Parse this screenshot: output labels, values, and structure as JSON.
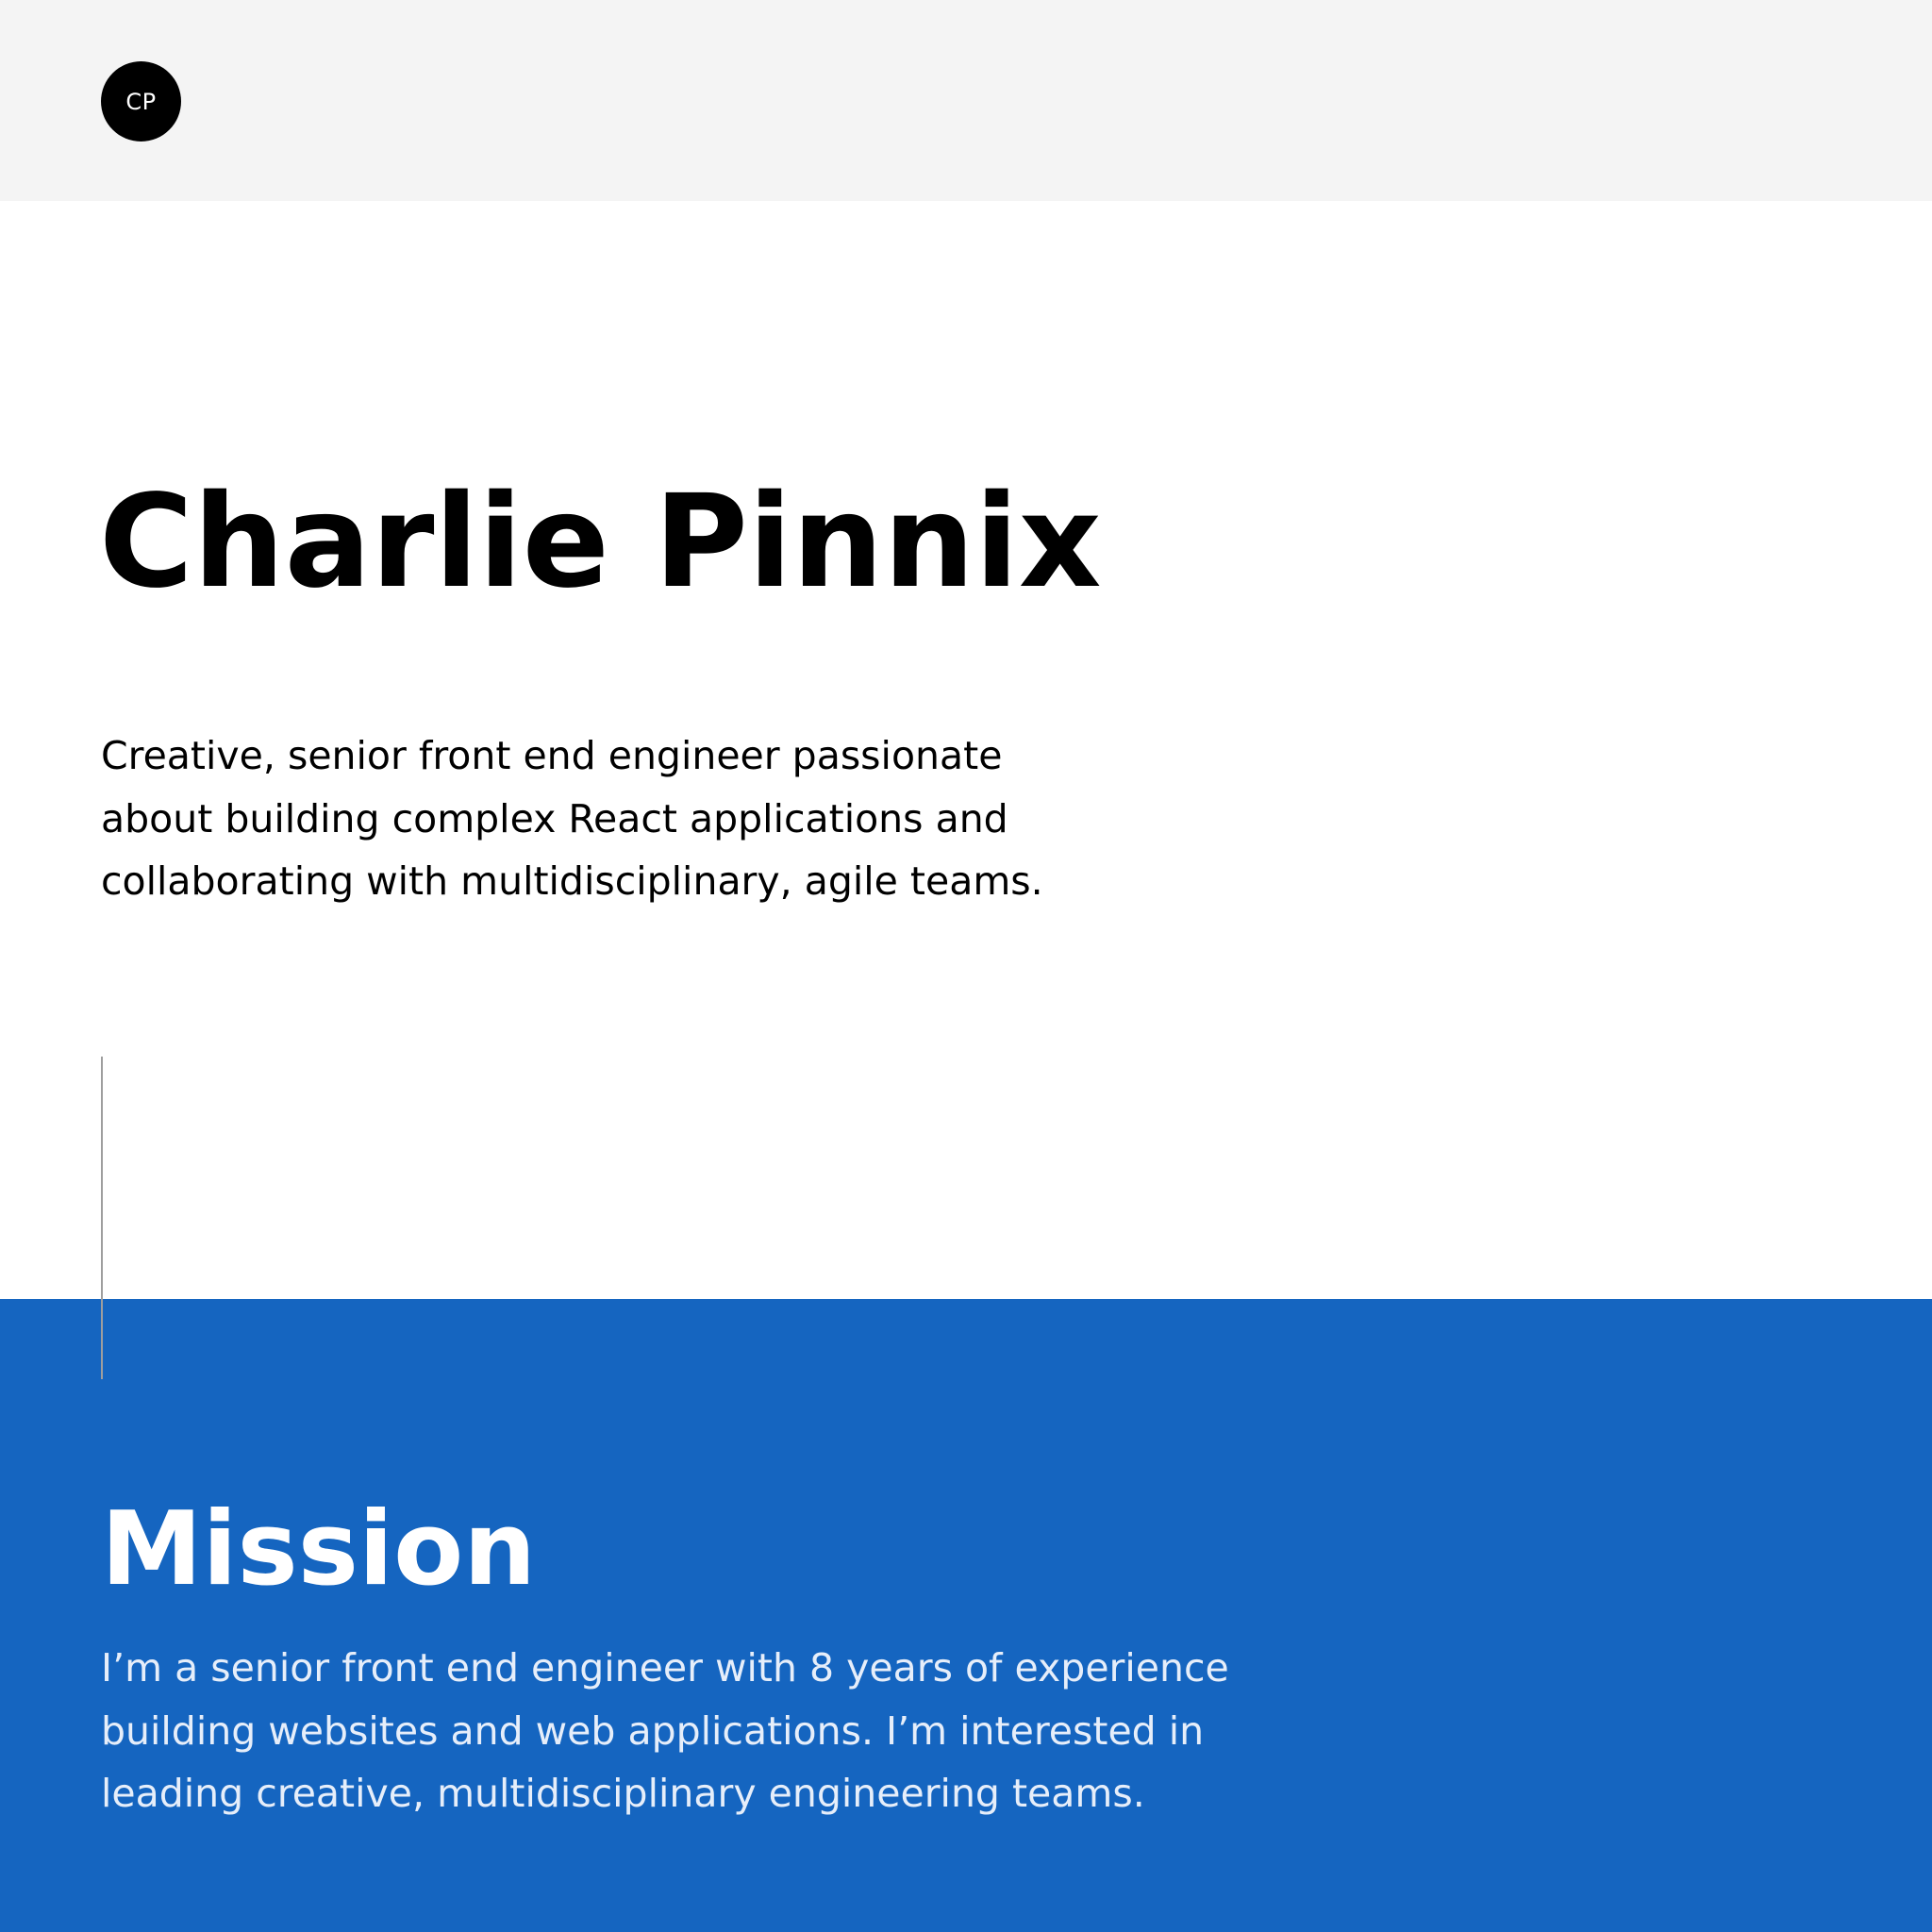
{
  "header": {
    "logo_initials": "CP"
  },
  "hero": {
    "name": "Charlie Pinnix",
    "description": "Creative, senior front end engineer passionate about building complex React applications and collaborating with multidisciplinary, agile teams."
  },
  "mission": {
    "title": "Mission",
    "description": "I’m a senior front end engineer with 8 years of experience building websites and web applications. I’m interested in leading creative, multidisciplinary engineering teams."
  },
  "colors": {
    "header_bg": "#f4f4f4",
    "accent_blue": "#1565c0",
    "logo_bg": "#000000"
  }
}
